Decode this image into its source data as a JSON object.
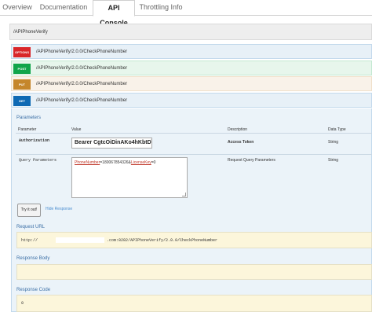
{
  "tabs": [
    {
      "label": "Overview"
    },
    {
      "label": "Documentation"
    },
    {
      "label": "API Console",
      "active": true
    },
    {
      "label": "Throttling Info"
    }
  ],
  "resource": {
    "title": "/APIPhoneVerify"
  },
  "operations": [
    {
      "method": "OPTIONS",
      "path": "/APIPhoneVerify/2.0.0/CheckPhoneNumber",
      "color": "#d9262a"
    },
    {
      "method": "POST",
      "path": "/APIPhoneVerify/2.0.0/CheckPhoneNumber",
      "color": "#10a54a"
    },
    {
      "method": "PUT",
      "path": "/APIPhoneVerify/2.0.0/CheckPhoneNumber",
      "color": "#c5862b"
    },
    {
      "method": "GET",
      "path": "/APIPhoneVerify/2.0.0/CheckPhoneNumber",
      "color": "#0f6ab4"
    }
  ],
  "parameters": {
    "title": "Parameters",
    "headers": {
      "parameter": "Parameter",
      "value": "Value",
      "description": "Description",
      "data_type": "Data Type"
    },
    "rows": [
      {
        "name": "Authorization",
        "value": "Bearer CgtcOiDinAKo4hKbtD\\",
        "description": "Access Token",
        "type": "String"
      },
      {
        "name": "Query Parameters",
        "value_key1": "PhoneNumber",
        "value_val1": "=180067854326&",
        "value_key2": "LicenseKey",
        "value_val2": "=0",
        "description": "Request Query Parameters",
        "type": "String"
      }
    ]
  },
  "actions": {
    "try_label": "Try it out!",
    "hide_label": "Hide Response"
  },
  "request_url": {
    "title": "Request URL",
    "prefix": "http://",
    "suffix": ".com:8282/APIPhoneVerify/2.0.0/CheckPhoneNumber"
  },
  "response_body": {
    "title": "Response Body"
  },
  "response_code": {
    "title": "Response Code",
    "value": "0"
  }
}
